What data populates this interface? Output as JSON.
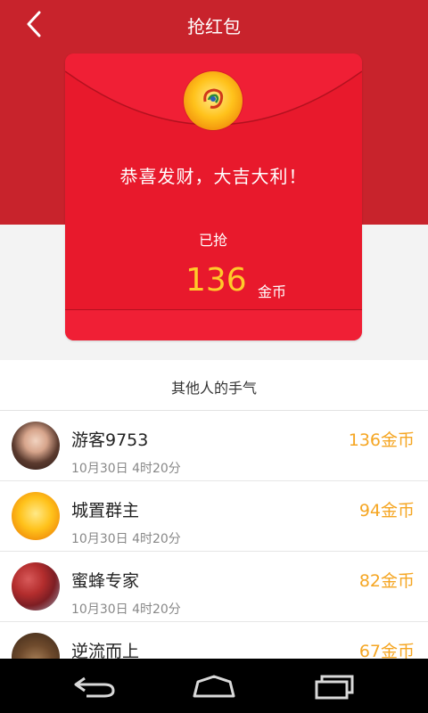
{
  "header": {
    "title": "抢红包"
  },
  "envelope": {
    "congrats": "恭喜发财，大吉大利！",
    "status": "已抢",
    "amount": "136",
    "unit": "金币"
  },
  "others_title": "其他人的手气",
  "records": [
    {
      "name": "游客9753",
      "time": "10月30日 4时20分",
      "coins": "136金币"
    },
    {
      "name": "城置群主",
      "time": "10月30日 4时20分",
      "coins": "94金币"
    },
    {
      "name": "蜜蜂专家",
      "time": "10月30日 4时20分",
      "coins": "82金币"
    },
    {
      "name": "逆流而上",
      "time": "",
      "coins": "67金币"
    }
  ],
  "colors": {
    "header_red": "#c8232c",
    "envelope_red": "#e8192c",
    "gold": "#ffca2a",
    "coin_orange": "#f5a623"
  },
  "icons": [
    "back-icon",
    "nav-back-icon",
    "nav-home-icon",
    "nav-recent-icon"
  ]
}
